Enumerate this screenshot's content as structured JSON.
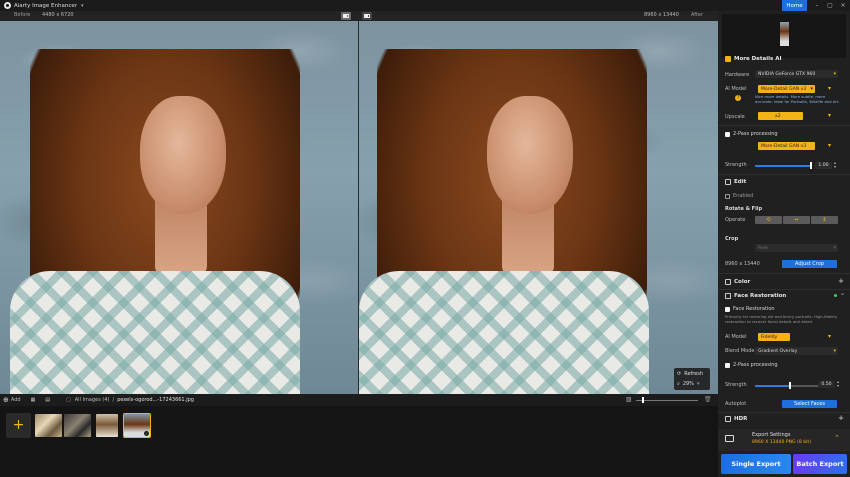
{
  "titlebar": {
    "app_title": "Aiarty Image Enhancer",
    "home_label": "Home"
  },
  "view": {
    "before_label": "Before",
    "before_resolution": "4480 x 6720",
    "after_resolution": "8960 x 13440",
    "after_label": "After"
  },
  "zoom": {
    "refresh_label": "Refresh",
    "zoom_value": "29%"
  },
  "strip": {
    "add_label": "Add",
    "breadcrumb_root": "All Images (4)",
    "breadcrumb_sep": "/",
    "breadcrumb_file": "pexels-ogorod...-17243661.jpg",
    "add_tile_glyph": "+"
  },
  "panel": {
    "more_details": {
      "title": "More Details AI",
      "hardware_label": "Hardware",
      "hardware_value": "NVIDIA GeForce GTX 960",
      "ai_model_label": "AI Model",
      "ai_model_value": "More-Detail GAN  v3",
      "ai_model_note": "Nice more details. More subtle, more accurate. Ideal for Portraits, Wildlife and Art.",
      "upscale_label": "Upscale",
      "upscale_value": "x2",
      "two_pass_label": "2-Pass processing",
      "two_pass_model": "More-Detail GAN  v3",
      "strength_label": "Strength",
      "strength_value": "1.00",
      "strength_level": 1.0
    },
    "edit": {
      "title": "Edit",
      "enabled_label": "Enabled",
      "rotate_label": "Rotate & Flip",
      "operate_label": "Operate",
      "rotate_buttons": [
        "⟲",
        "⇔",
        "⇕"
      ],
      "crop_label": "Crop",
      "crop_value": "Free",
      "resolution": "8960 x 13440",
      "adjust_crop_label": "Adjust Crop"
    },
    "color": {
      "title": "Color"
    },
    "face": {
      "title": "Face Restoration",
      "checkbox_label": "Face Restoration",
      "note": "Primarily for restoring old and blurry portraits. High-fidelity restoration to recover facial details and detail.",
      "ai_model_label": "AI Model",
      "ai_model_value": "Fidelity",
      "blend_label": "Blend Mode",
      "blend_value": "Gradient Overlay",
      "two_pass_label": "2-Pass processing",
      "strength_label": "Strength",
      "strength_value": "0.50",
      "strength_level": 0.5,
      "autoplot_label": "Autoplot",
      "select_faces_label": "Select Faces"
    },
    "hdr": {
      "title": "HDR"
    },
    "export": {
      "settings_title": "Export Settings",
      "settings_detail": "8960 X 13440  PNG  (8 bit)",
      "single_label": "Single Export",
      "batch_label": "Batch Export"
    }
  },
  "colors": {
    "accent_yellow": "#f2b315",
    "accent_blue": "#1e6fd9",
    "batch_purple": "#6a3cf0"
  }
}
